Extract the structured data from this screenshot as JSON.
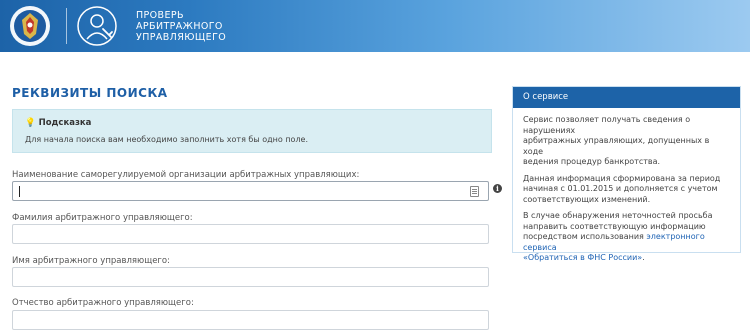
{
  "header": {
    "title_lines": [
      "ПРОВЕРЬ",
      "АРБИТРАЖНОГО",
      "УПРАВЛЯЮЩЕГО"
    ],
    "logo_icon": "fns-emblem-icon",
    "service_icon": "manager-wrench-icon"
  },
  "page_title": "РЕКВИЗИТЫ ПОИСКА",
  "hint": {
    "title": "Подсказка",
    "text": "Для начала поиска вам необходимо заполнить хотя бы одно поле."
  },
  "fields": [
    {
      "label": "Наименование саморегулируемой организации арбитражных управляющих:",
      "value": ""
    },
    {
      "label": "Фамилия арбитражного управляющего:",
      "value": ""
    },
    {
      "label": "Имя арбитражного управляющего:",
      "value": ""
    },
    {
      "label": "Отчество арбитражного управляющего:",
      "value": ""
    }
  ],
  "sidebar": {
    "title": "О сервисе",
    "p1_lines": [
      "Сервис позволяет получать сведения о нарушениях",
      "арбитражных управляющих, допущенных в ходе",
      "ведения процедур банкротства."
    ],
    "p2_lines": [
      "Данная информация сформирована за период",
      "начиная с 01.01.2015 и дополняется с учетом",
      "соответствующих изменений."
    ],
    "p3_lines": [
      "В случае обнаружения неточностей просьба",
      "направить соответствующую информацию"
    ],
    "p3_mixed": "посредством использования ",
    "p3_link1": "электронного сервиса",
    "p3_link2": "«Обратиться в ФНС России»",
    "p3_end": "."
  },
  "colors": {
    "brand_blue": "#1d63a8",
    "title_blue": "#1e5fa6",
    "hint_bg": "#daeef3",
    "link": "#1e63b4"
  }
}
